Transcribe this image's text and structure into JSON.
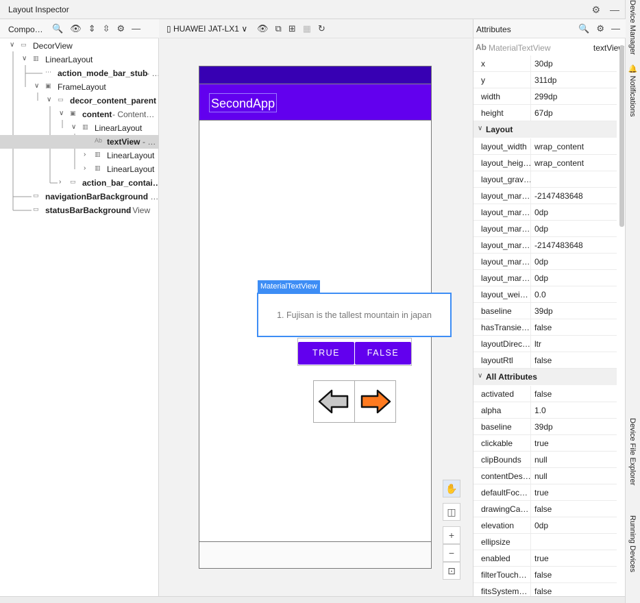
{
  "window": {
    "title": "Layout Inspector"
  },
  "right_sidebar": {
    "tabs": [
      "Device Manager",
      "Notifications",
      "Device File Explorer",
      "Running Devices"
    ]
  },
  "component_tree": {
    "label": "Compo…",
    "nodes": [
      {
        "name": "DecorView",
        "suffix": ""
      },
      {
        "name": "LinearLayout",
        "suffix": ""
      },
      {
        "name": "action_mode_bar_stub",
        "suffix": " - …"
      },
      {
        "name": "FrameLayout",
        "suffix": ""
      },
      {
        "name": "decor_content_parent",
        "suffix": ""
      },
      {
        "name": "content",
        "suffix": " - Content…"
      },
      {
        "name": "LinearLayout",
        "suffix": ""
      },
      {
        "name": "textView",
        "suffix": " - …"
      },
      {
        "name": "LinearLayout",
        "suffix": ""
      },
      {
        "name": "LinearLayout",
        "suffix": ""
      },
      {
        "name": "action_bar_contai…",
        "suffix": ""
      },
      {
        "name": "navigationBarBackground",
        "suffix": " - …"
      },
      {
        "name": "statusBarBackground",
        "suffix": " - View"
      }
    ]
  },
  "device": {
    "name": "HUAWEI JAT-LX1"
  },
  "app": {
    "title": "SecondApp",
    "selected_tag": "MaterialTextView",
    "question": "1. Fujisan is the tallest mountain in japan",
    "true_label": "TRUE",
    "false_label": "FALSE"
  },
  "attributes": {
    "label": "Attributes",
    "type_badge": "Ab",
    "type_name": "MaterialTextView",
    "id_name": "textView",
    "basic": [
      {
        "k": "x",
        "v": "30dp"
      },
      {
        "k": "y",
        "v": "311dp"
      },
      {
        "k": "width",
        "v": "299dp"
      },
      {
        "k": "height",
        "v": "67dp"
      }
    ],
    "layout_title": "Layout",
    "layout": [
      {
        "k": "layout_width",
        "v": "wrap_content"
      },
      {
        "k": "layout_heig…",
        "v": "wrap_content"
      },
      {
        "k": "layout_grav…",
        "v": ""
      },
      {
        "k": "layout_mar…",
        "v": "-2147483648"
      },
      {
        "k": "layout_mar…",
        "v": "0dp"
      },
      {
        "k": "layout_mar…",
        "v": "0dp"
      },
      {
        "k": "layout_mar…",
        "v": "-2147483648"
      },
      {
        "k": "layout_mar…",
        "v": "0dp"
      },
      {
        "k": "layout_mar…",
        "v": "0dp"
      },
      {
        "k": "layout_wei…",
        "v": "0.0"
      },
      {
        "k": "baseline",
        "v": "39dp"
      },
      {
        "k": "hasTransie…",
        "v": "false"
      },
      {
        "k": "layoutDirec…",
        "v": "ltr"
      },
      {
        "k": "layoutRtl",
        "v": "false"
      }
    ],
    "all_title": "All Attributes",
    "all": [
      {
        "k": "activated",
        "v": "false"
      },
      {
        "k": "alpha",
        "v": "1.0"
      },
      {
        "k": "baseline",
        "v": "39dp"
      },
      {
        "k": "clickable",
        "v": "true"
      },
      {
        "k": "clipBounds",
        "v": "null"
      },
      {
        "k": "contentDes…",
        "v": "null"
      },
      {
        "k": "defaultFoc…",
        "v": "true"
      },
      {
        "k": "drawingCa…",
        "v": "false"
      },
      {
        "k": "elevation",
        "v": "0dp"
      },
      {
        "k": "ellipsize",
        "v": ""
      },
      {
        "k": "enabled",
        "v": "true"
      },
      {
        "k": "filterTouch…",
        "v": "false"
      },
      {
        "k": "fitsSystem…",
        "v": "false"
      }
    ]
  },
  "colors": {
    "primary": "#6200ee",
    "primary_dark": "#3700b3",
    "selection": "#3d8df5",
    "arrow_left": "#c8c8c8",
    "arrow_right": "#ff7a1f"
  }
}
